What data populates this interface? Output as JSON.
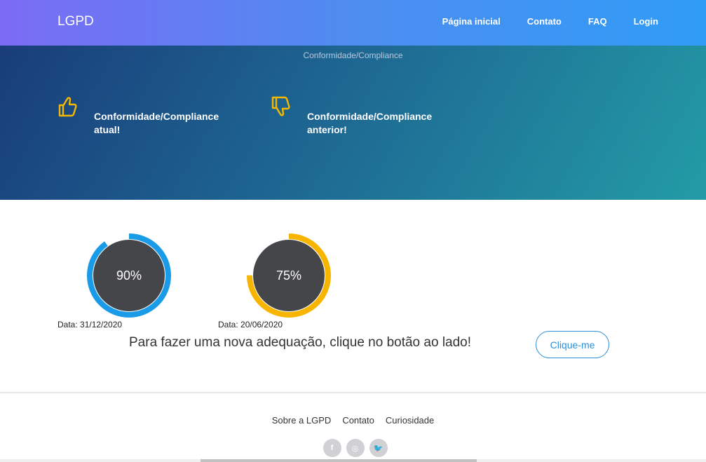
{
  "navbar": {
    "brand": "LGPD",
    "links": [
      "Página inicial",
      "Contato",
      "FAQ",
      "Login"
    ]
  },
  "hero": {
    "title": "Conformidade/Compliance",
    "items": [
      {
        "label": "Conformidade/Compliance atual!",
        "icon": "thumbs-up-icon"
      },
      {
        "label": "Conformidade/Compliance anterior!",
        "icon": "thumbs-down-icon"
      }
    ]
  },
  "gauges": [
    {
      "value": "90%",
      "percent": 90,
      "date": "Data: 31/12/2020",
      "color": "#1a9be8"
    },
    {
      "value": "75%",
      "percent": 75,
      "date": "Data: 20/06/2020",
      "color": "#f7b500"
    }
  ],
  "cta": {
    "text": "Para fazer uma nova adequação, clique no botão ao lado!",
    "button": "Clique-me"
  },
  "footer": {
    "links": [
      "Sobre a LGPD",
      "Contato",
      "Curiosidade"
    ],
    "social": [
      {
        "icon": "facebook-icon",
        "glyph": "f"
      },
      {
        "icon": "instagram-icon",
        "glyph": "◎"
      },
      {
        "icon": "twitter-icon",
        "glyph": "🐦"
      }
    ]
  },
  "colors": {
    "accent_icon": "#f5b800",
    "gauge_center": "#454649",
    "button": "#2a8fd6"
  }
}
